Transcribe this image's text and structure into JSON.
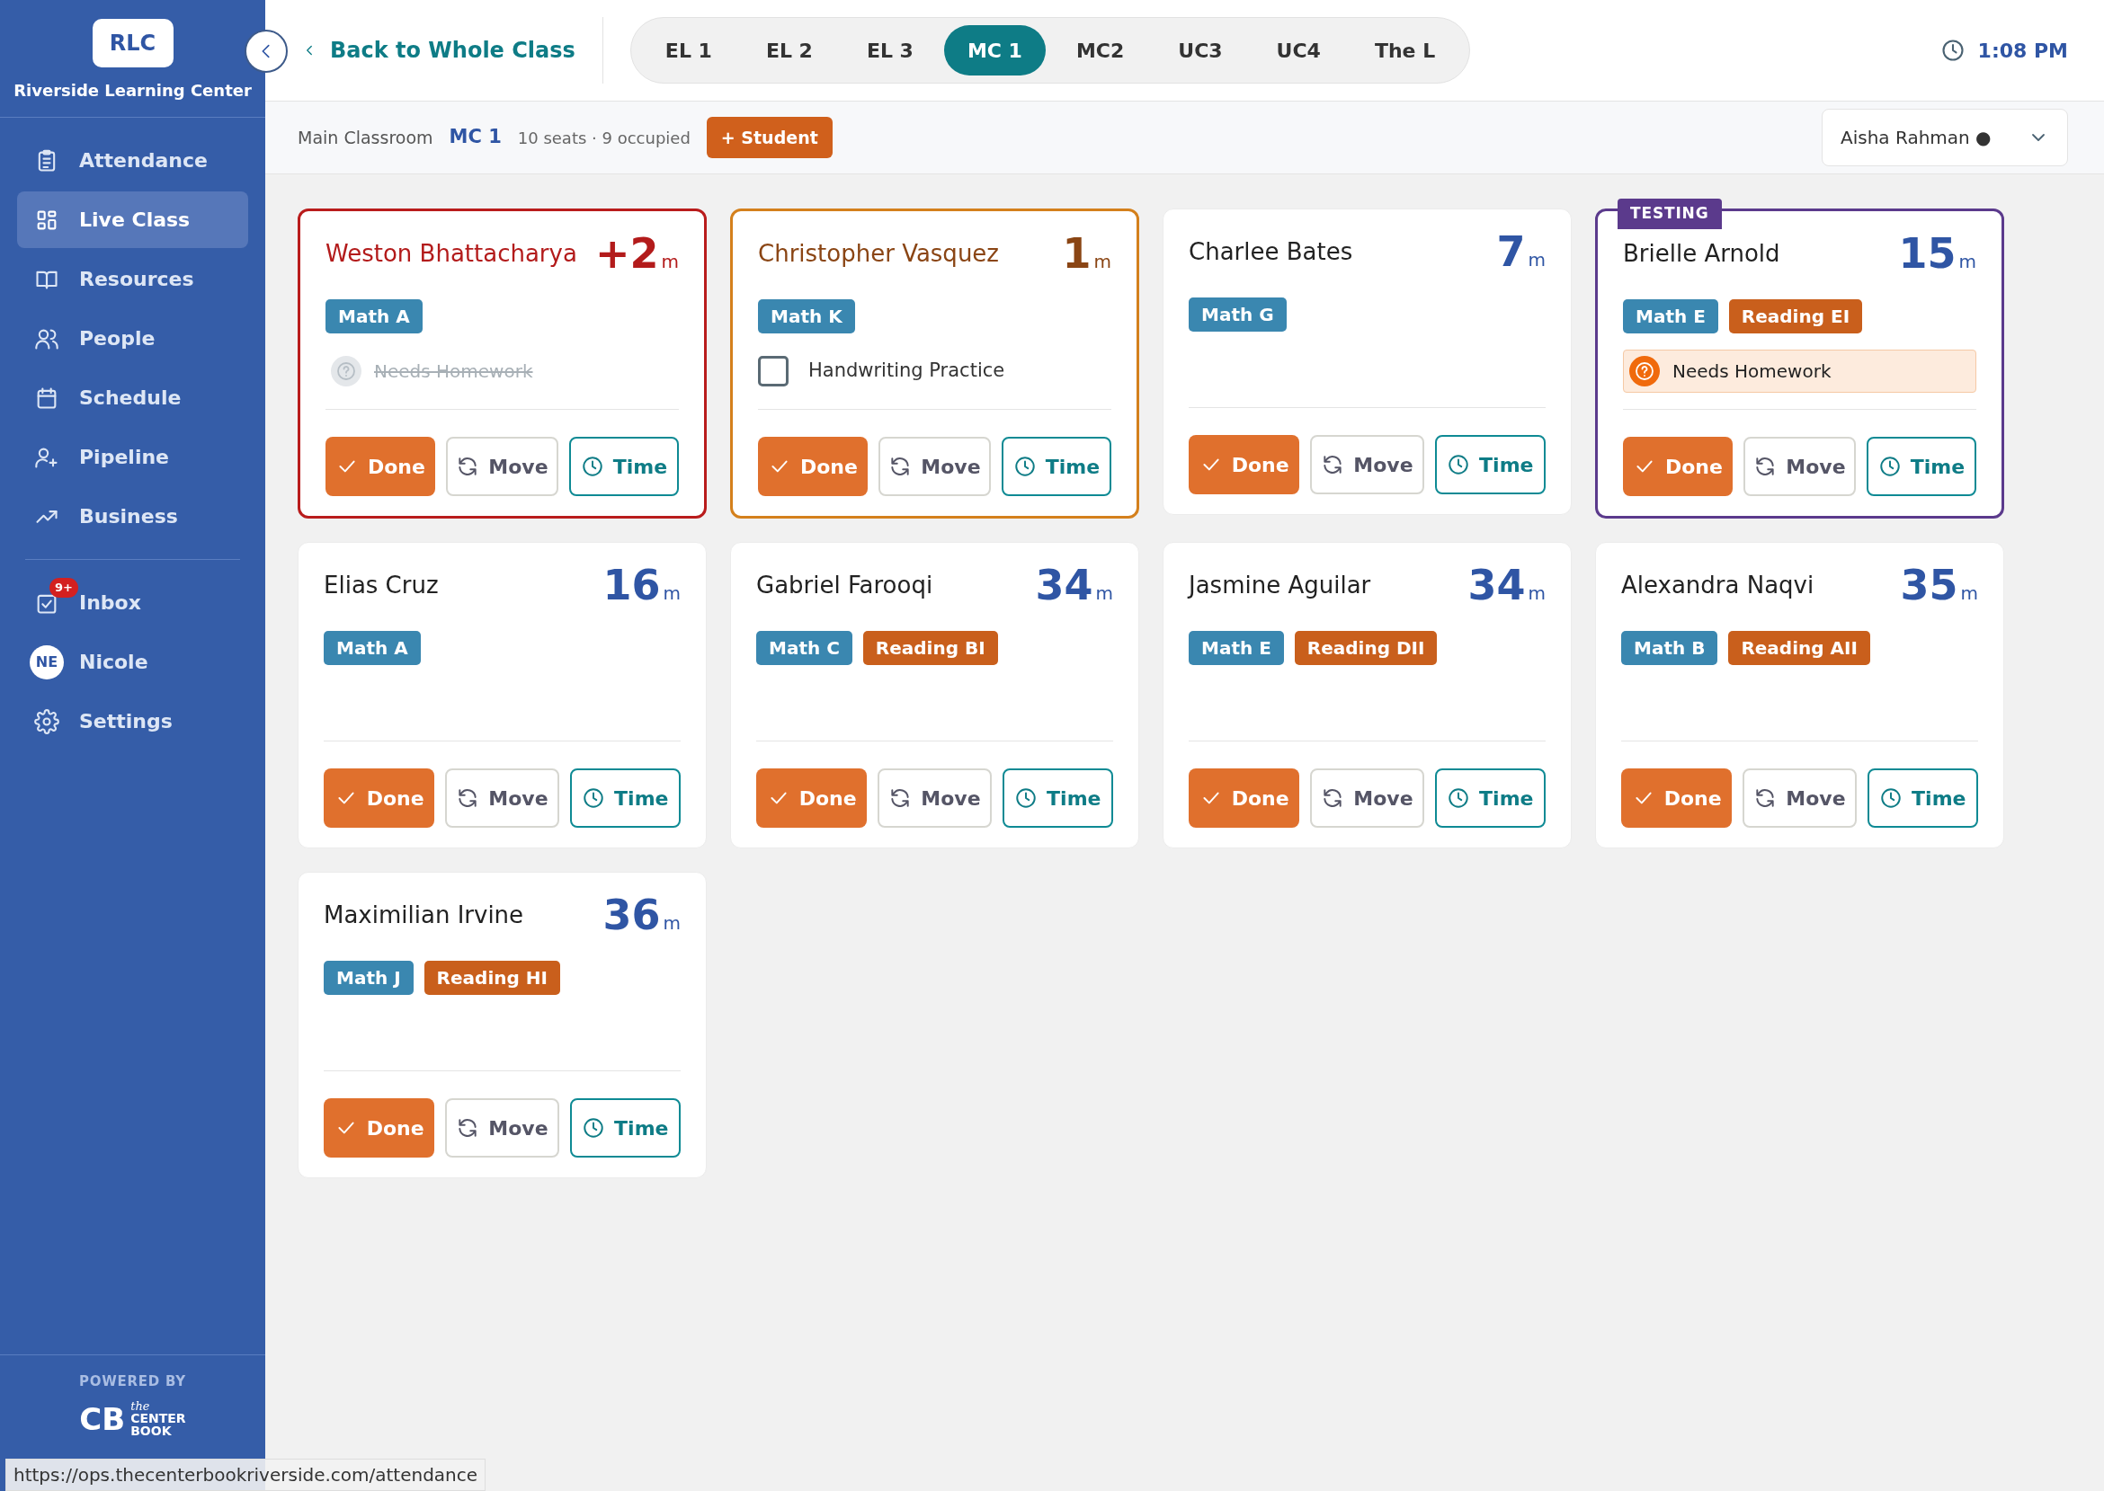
{
  "sidebar": {
    "logo": "RLC",
    "org_name": "Riverside Learning Center",
    "items": [
      {
        "label": "Attendance",
        "selected": false
      },
      {
        "label": "Live Class",
        "selected": true
      },
      {
        "label": "Resources",
        "selected": false
      },
      {
        "label": "People",
        "selected": false
      },
      {
        "label": "Schedule",
        "selected": false
      },
      {
        "label": "Pipeline",
        "selected": false
      },
      {
        "label": "Business",
        "selected": false
      }
    ],
    "secondary_items": [
      {
        "label": "Inbox",
        "badge": "9+"
      },
      {
        "label": "Nicole",
        "avatar": "NE"
      },
      {
        "label": "Settings"
      }
    ],
    "powered_by": "POWERED BY",
    "brand_logo": {
      "mark": "CB",
      "small": "the",
      "line1": "CENTER",
      "line2": "BOOK"
    }
  },
  "header": {
    "back": "Back to Whole Class",
    "tabs": [
      {
        "label": "EL 1",
        "selected": false
      },
      {
        "label": "EL 2",
        "selected": false
      },
      {
        "label": "EL 3",
        "selected": false
      },
      {
        "label": "MC 1",
        "selected": true
      },
      {
        "label": "MC2",
        "selected": false
      },
      {
        "label": "UC3",
        "selected": false
      },
      {
        "label": "UC4",
        "selected": false
      },
      {
        "label": "The L",
        "selected": false
      }
    ],
    "time": "1:08 PM"
  },
  "subheader": {
    "room": "Main Classroom",
    "room_code": "MC 1",
    "occupancy": "10 seats · 9 occupied",
    "add_button": "+ Student",
    "staff_select": "Aisha Rahman ●"
  },
  "cards": [
    {
      "kind": "overdue",
      "name": "Weston Bhattacharya",
      "time": "+2",
      "unit": "m",
      "tags": [
        {
          "kind": "math",
          "label": "Math A"
        }
      ],
      "tasks": [
        {
          "kind": "homework",
          "label": "Needs Homework",
          "completed": true
        }
      ],
      "actions": [
        {
          "kind": "done",
          "label": "Done"
        },
        {
          "kind": "move",
          "label": "Move"
        },
        {
          "kind": "time",
          "label": "Time"
        }
      ]
    },
    {
      "kind": "warning",
      "name": "Christopher Vasquez",
      "time": "1",
      "unit": "m",
      "tags": [
        {
          "kind": "math",
          "label": "Math K"
        }
      ],
      "tasks": [
        {
          "kind": "checkbox",
          "label": "Handwriting Practice",
          "checked": false
        }
      ],
      "actions": [
        {
          "kind": "done",
          "label": "Done"
        },
        {
          "kind": "move",
          "label": "Move"
        },
        {
          "kind": "time",
          "label": "Time"
        }
      ]
    },
    {
      "kind": "normal",
      "name": "Charlee Bates",
      "time": "7",
      "unit": "m",
      "tags": [
        {
          "kind": "math",
          "label": "Math G"
        }
      ],
      "actions": [
        {
          "kind": "done",
          "label": "Done"
        },
        {
          "kind": "move",
          "label": "Move"
        },
        {
          "kind": "time",
          "label": "Time"
        }
      ]
    },
    {
      "kind": "testing",
      "badge": "TESTING",
      "name": "Brielle Arnold",
      "time": "15",
      "unit": "m",
      "tags": [
        {
          "kind": "math",
          "label": "Math E"
        },
        {
          "kind": "reading",
          "label": "Reading EI"
        }
      ],
      "tasks": [
        {
          "kind": "homework",
          "label": "Needs Homework",
          "completed": false
        }
      ],
      "actions": [
        {
          "kind": "done",
          "label": "Done"
        },
        {
          "kind": "move",
          "label": "Move"
        },
        {
          "kind": "time",
          "label": "Time"
        }
      ]
    },
    {
      "kind": "normal",
      "name": "Elias Cruz",
      "time": "16",
      "unit": "m",
      "tags": [
        {
          "kind": "math",
          "label": "Math A"
        }
      ],
      "actions": [
        {
          "kind": "done",
          "label": "Done"
        },
        {
          "kind": "move",
          "label": "Move"
        },
        {
          "kind": "time",
          "label": "Time"
        }
      ]
    },
    {
      "kind": "normal",
      "name": "Gabriel Farooqi",
      "time": "34",
      "unit": "m",
      "tags": [
        {
          "kind": "math",
          "label": "Math C"
        },
        {
          "kind": "reading",
          "label": "Reading BI"
        }
      ],
      "actions": [
        {
          "kind": "done",
          "label": "Done"
        },
        {
          "kind": "move",
          "label": "Move"
        },
        {
          "kind": "time",
          "label": "Time"
        }
      ]
    },
    {
      "kind": "normal",
      "name": "Jasmine Aguilar",
      "time": "34",
      "unit": "m",
      "tags": [
        {
          "kind": "math",
          "label": "Math E"
        },
        {
          "kind": "reading",
          "label": "Reading DII"
        }
      ],
      "actions": [
        {
          "kind": "done",
          "label": "Done"
        },
        {
          "kind": "move",
          "label": "Move"
        },
        {
          "kind": "time",
          "label": "Time"
        }
      ]
    },
    {
      "kind": "normal",
      "name": "Alexandra Naqvi",
      "time": "35",
      "unit": "m",
      "tags": [
        {
          "kind": "math",
          "label": "Math B"
        },
        {
          "kind": "reading",
          "label": "Reading AII"
        }
      ],
      "actions": [
        {
          "kind": "done",
          "label": "Done"
        },
        {
          "kind": "move",
          "label": "Move"
        },
        {
          "kind": "time",
          "label": "Time"
        }
      ]
    },
    {
      "kind": "normal",
      "name": "Maximilian Irvine",
      "time": "36",
      "unit": "m",
      "tags": [
        {
          "kind": "math",
          "label": "Math J"
        },
        {
          "kind": "reading",
          "label": "Reading HI"
        }
      ],
      "actions": [
        {
          "kind": "done",
          "label": "Done"
        },
        {
          "kind": "move",
          "label": "Move"
        },
        {
          "kind": "time",
          "label": "Time"
        }
      ]
    }
  ],
  "status_bar": "https://ops.thecenterbookriverside.com/attendance"
}
